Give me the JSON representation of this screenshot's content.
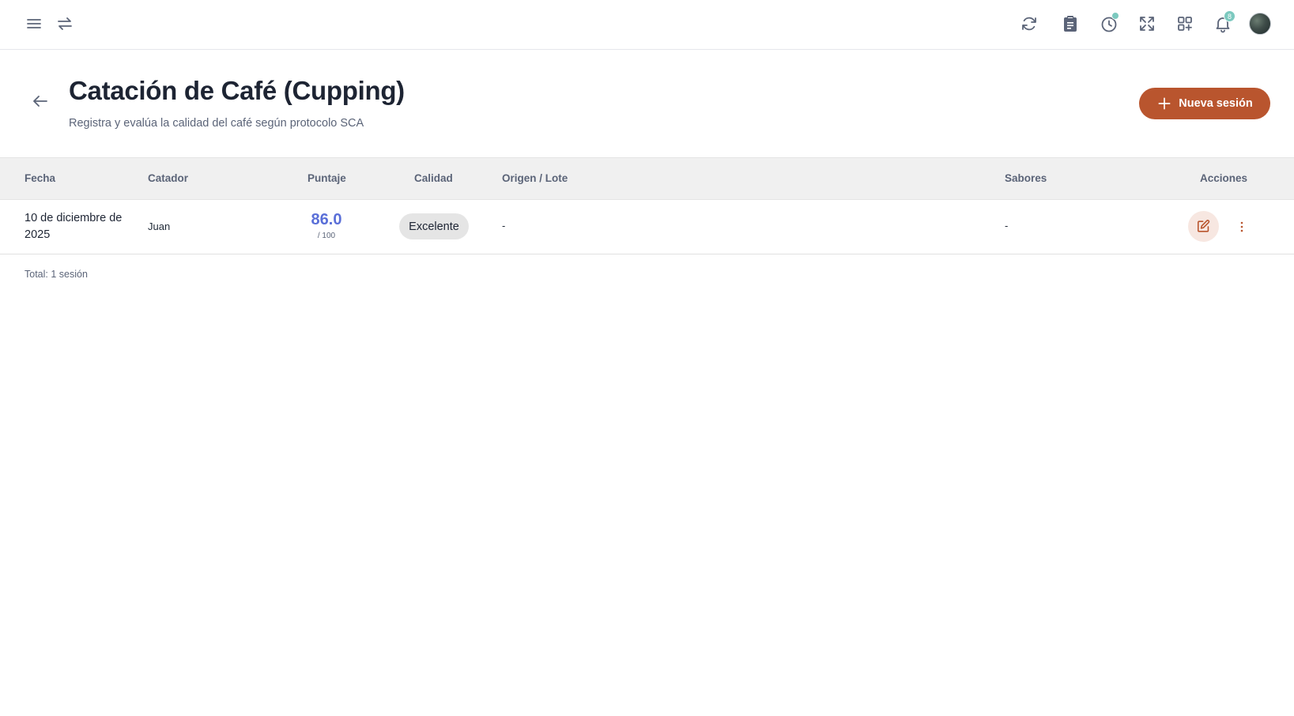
{
  "topbar": {
    "left_icons": [
      "menu-icon",
      "swap-icon"
    ],
    "right_icons": [
      "refresh-icon",
      "clipboard-icon",
      "clock-icon",
      "fullscreen-icon",
      "apps-icon",
      "bell-icon"
    ],
    "notification_count": "8",
    "accent_color": "#7cc9bf"
  },
  "header": {
    "title": "Catación de Café (Cupping)",
    "subtitle": "Registra y evalúa la calidad del café según protocolo SCA",
    "new_button_label": "Nueva sesión",
    "brand_color": "#b9552e"
  },
  "table": {
    "columns": {
      "fecha": "Fecha",
      "catador": "Catador",
      "puntaje": "Puntaje",
      "calidad": "Calidad",
      "origen": "Origen / Lote",
      "sabores": "Sabores",
      "acciones": "Acciones"
    },
    "rows": [
      {
        "fecha": "10 de diciembre de 2025",
        "catador": "Juan",
        "puntaje": "86.0",
        "puntaje_max": "/ 100",
        "calidad": "Excelente",
        "origen": "-",
        "sabores": "-"
      }
    ],
    "total_label": "Total: 1 sesión"
  }
}
